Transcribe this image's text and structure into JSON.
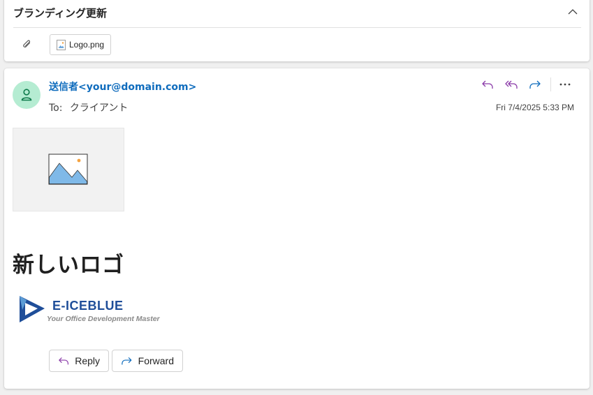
{
  "header": {
    "subject": "ブランディング更新",
    "attachment_name": "Logo.png"
  },
  "message": {
    "sender_name": "送信者",
    "sender_address": "<your@domain.com>",
    "to_label": "To:",
    "recipient": "クライアント",
    "date": "Fri 7/4/2025 5:33 PM",
    "heading": "新しいロゴ",
    "logo_title": "E-ICEBLUE",
    "logo_tagline": "Your Office Development Master"
  },
  "actions": {
    "reply_label": "Reply",
    "forward_label": "Forward"
  },
  "icons": {
    "collapse": "chevron-up-icon",
    "attachment": "paperclip-icon",
    "avatar": "person-icon",
    "reply": "reply-icon",
    "reply_all": "reply-all-icon",
    "forward": "forward-icon",
    "more": "more-icon",
    "image": "image-placeholder-icon"
  },
  "colors": {
    "accent": "#0f6cbd",
    "avatar_bg": "#b5ecd2",
    "reply_icon": "#8a3aa8",
    "forward_icon": "#0f6cbd"
  }
}
